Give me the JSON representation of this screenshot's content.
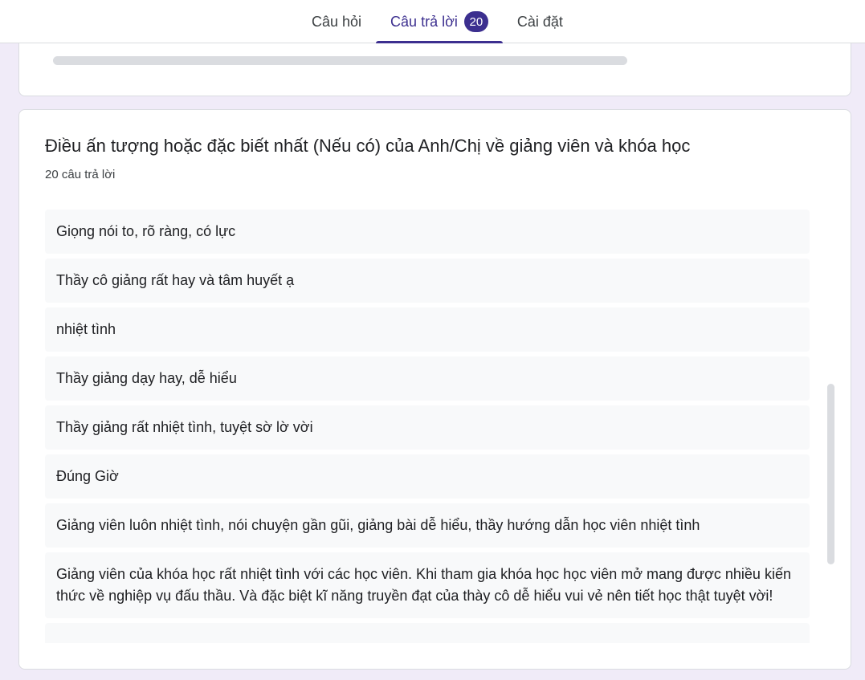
{
  "tabs": [
    {
      "label": "Câu hỏi"
    },
    {
      "label": "Câu trả lời",
      "badge": "20"
    },
    {
      "label": "Cài đặt"
    }
  ],
  "question": {
    "title": "Điều ấn tượng hoặc đặc biết nhất (Nếu có) của Anh/Chị về giảng viên và khóa học",
    "count": "20 câu trả lời"
  },
  "answers": [
    "Giọng nói to, rõ ràng, có lực",
    "Thầy cô giảng rất hay và tâm huyết ạ",
    "nhiệt tình",
    "Thầy giảng dạy hay, dễ hiểu",
    "Thầy giảng rất nhiệt tình, tuyệt sờ lờ vời",
    "Đúng Giờ",
    "Giảng viên luôn nhiệt tình, nói chuyện gần gũi, giảng bài dễ hiểu, thầy hướng dẫn học viên nhiệt tình",
    "Giảng viên của khóa học rất nhiệt tình với các học viên. Khi tham gia khóa học học viên mở mang được nhiều kiến thức về nghiệp vụ đấu thầu. Và đặc biệt kĩ năng truyền đạt của thày cô dễ hiểu vui vẻ nên tiết học thật tuyệt vời!",
    ""
  ],
  "colors": {
    "accent": "#3c2f8f",
    "background": "#f0ebf8",
    "answer_bg": "#f8f9fa"
  }
}
